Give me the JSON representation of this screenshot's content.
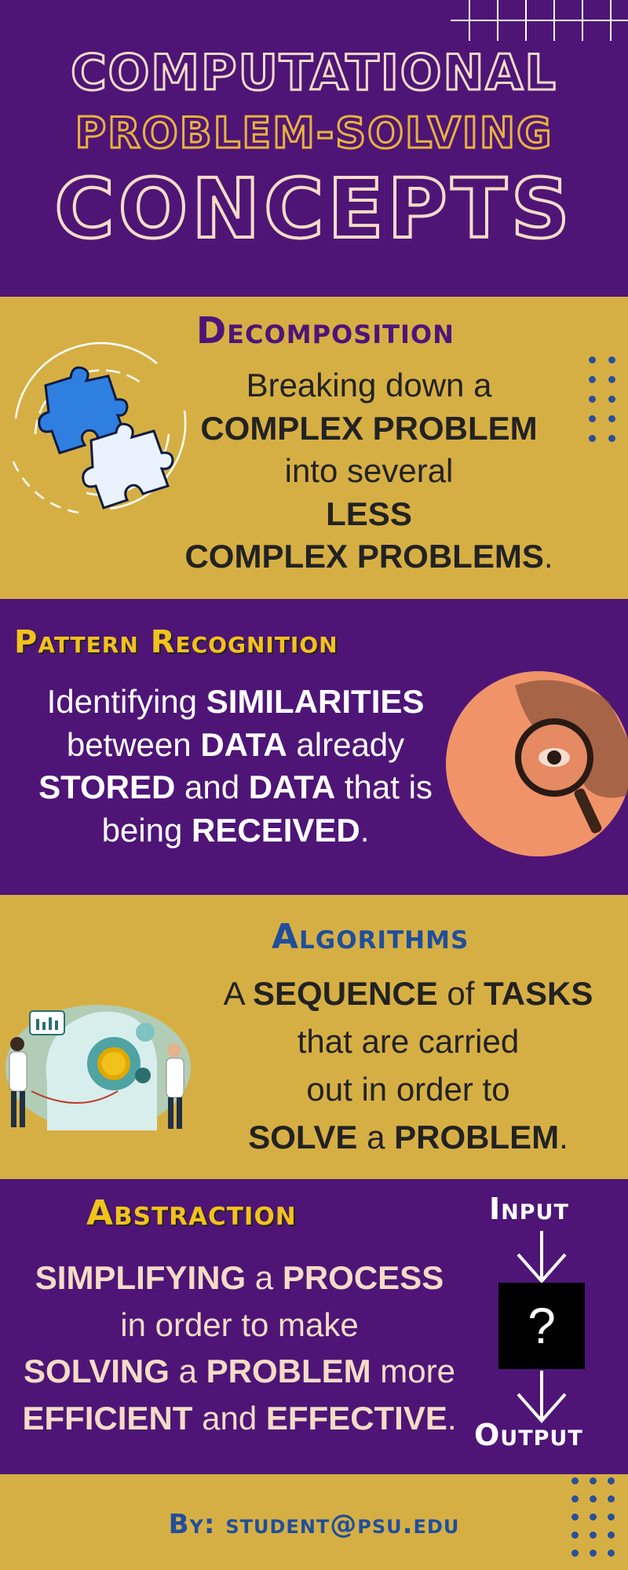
{
  "title": {
    "line1": "COMPUTATIONAL",
    "line2": "PROBLEM-SOLVING",
    "line3": "CONCEPTS"
  },
  "decomposition": {
    "heading": "Decomposition",
    "lines": [
      [
        "Breaking down a"
      ],
      [
        "COMPLEX PROBLEM"
      ],
      [
        "into several"
      ],
      [
        "LESS"
      ],
      [
        "COMPLEX PROBLEMS",
        "."
      ]
    ]
  },
  "pattern": {
    "heading": "Pattern Recognition",
    "lines": [
      [
        "Identifying ",
        "SIMILARITIES"
      ],
      [
        "between ",
        "DATA",
        " already"
      ],
      [
        "STORED",
        " and ",
        "DATA",
        " that is"
      ],
      [
        "being ",
        "RECEIVED",
        "."
      ]
    ]
  },
  "algorithms": {
    "heading": "Algorithms",
    "lines": [
      [
        "A ",
        "SEQUENCE",
        " of ",
        "TASKS"
      ],
      [
        "that are carried"
      ],
      [
        "out in order to"
      ],
      [
        "SOLVE",
        " a ",
        "PROBLEM",
        "."
      ]
    ]
  },
  "abstraction": {
    "heading": "Abstraction",
    "lines": [
      [
        "SIMPLIFYING",
        " a ",
        "PROCESS"
      ],
      [
        "in order to make"
      ],
      [
        "SOLVING",
        " a ",
        "PROBLEM",
        " more"
      ],
      [
        "EFFICIENT",
        " and ",
        "EFFECTIVE",
        "."
      ]
    ],
    "input_label": "Input",
    "box_symbol": "?",
    "output_label": "Output"
  },
  "footer": {
    "byline": "By: student@psu.edu"
  },
  "colors": {
    "purple": "#4e1577",
    "gold": "#d6af44",
    "cream": "#f6dcc6",
    "dark_text": "#222222",
    "blue_heading": "#1f4f9c",
    "yellow_heading": "#f2c21c"
  }
}
